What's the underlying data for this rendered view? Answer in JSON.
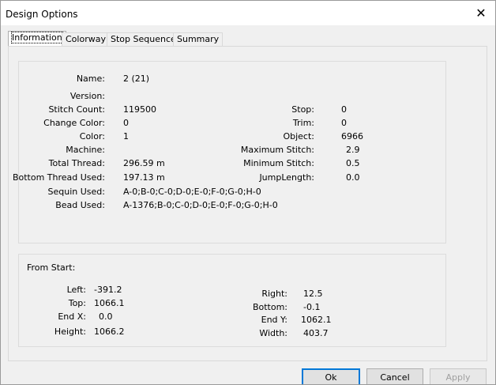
{
  "window": {
    "title": "Design Options",
    "close_icon": "close-icon"
  },
  "tabs": [
    "Information",
    "Colorway",
    "Stop Sequence",
    "Summary"
  ],
  "info": {
    "name": {
      "label": "Name:",
      "value": "2 (21)"
    },
    "version": {
      "label": "Version:",
      "value": ""
    },
    "stitch_count": {
      "label": "Stitch Count:",
      "value": "119500"
    },
    "change_color": {
      "label": "Change Color:",
      "value": "0"
    },
    "color": {
      "label": "Color:",
      "value": "1"
    },
    "machine": {
      "label": "Machine:",
      "value": ""
    },
    "total_thread": {
      "label": "Total Thread:",
      "value": "296.59 m"
    },
    "bottom_thread": {
      "label": "Bottom Thread Used:",
      "value": "197.13 m"
    },
    "sequin_used": {
      "label": "Sequin Used:",
      "value": "A-0;B-0;C-0;D-0;E-0;F-0;G-0;H-0"
    },
    "bead_used": {
      "label": "Bead Used:",
      "value": "A-1376;B-0;C-0;D-0;E-0;F-0;G-0;H-0"
    },
    "stop": {
      "label": "Stop:",
      "value": "0"
    },
    "trim": {
      "label": "Trim:",
      "value": "0"
    },
    "object": {
      "label": "Object:",
      "value": "6966"
    },
    "max_stitch": {
      "label": "Maximum Stitch:",
      "value": "2.9"
    },
    "min_stitch": {
      "label": "Minimum Stitch:",
      "value": "0.5"
    },
    "jump_length": {
      "label": "JumpLength:",
      "value": "0.0"
    }
  },
  "from_start": {
    "title": "From Start:",
    "left": {
      "label": "Left:",
      "value": "-391.2"
    },
    "top": {
      "label": "Top:",
      "value": "1066.1"
    },
    "end_x": {
      "label": "End X:",
      "value": "0.0"
    },
    "height": {
      "label": "Height:",
      "value": "1066.2"
    },
    "right": {
      "label": "Right:",
      "value": "12.5"
    },
    "bottom": {
      "label": "Bottom:",
      "value": "-0.1"
    },
    "end_y": {
      "label": "End Y:",
      "value": "1062.1"
    },
    "width": {
      "label": "Width:",
      "value": "403.7"
    }
  },
  "buttons": {
    "ok": "Ok",
    "cancel": "Cancel",
    "apply": "Apply"
  }
}
